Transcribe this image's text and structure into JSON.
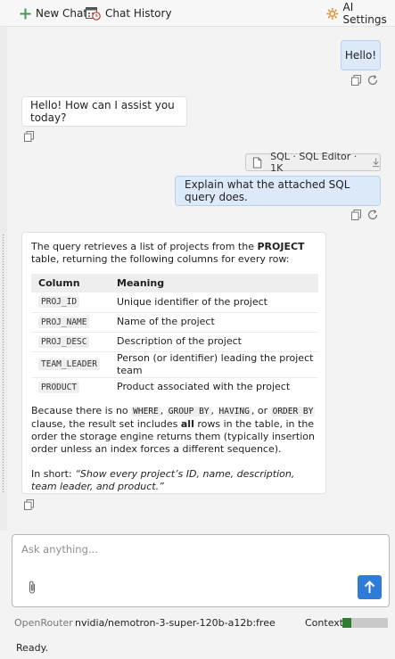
{
  "toolbar": {
    "new_chat": "New Chat",
    "chat_history": "Chat History",
    "ai_settings": "AI Settings"
  },
  "messages": {
    "user_1": "Hello!",
    "ai_1": "Hello! How can I assist you today?",
    "attachment": {
      "label": "SQL · SQL Editor · 1K"
    },
    "user_2": "Explain what the attached SQL query does.",
    "ai_2": {
      "intro_prefix": "The query retrieves a list of projects from the ",
      "intro_table": "PROJECT",
      "intro_suffix": " table, returning the following columns for every row:",
      "table_headers": [
        "Column",
        "Meaning"
      ],
      "rows": [
        {
          "column": "PROJ_ID",
          "meaning": "Unique identifier of the project"
        },
        {
          "column": "PROJ_NAME",
          "meaning": "Name of the project"
        },
        {
          "column": "PROJ_DESC",
          "meaning": "Description of the project"
        },
        {
          "column": "TEAM_LEADER",
          "meaning": "Person (or identifier) leading the project team"
        },
        {
          "column": "PRODUCT",
          "meaning": "Product associated with the project"
        }
      ],
      "para2_a": "Because there is no ",
      "kw_where": "WHERE",
      "para2_b": ", ",
      "kw_group": "GROUP BY",
      "para2_c": ", ",
      "kw_having": "HAVING",
      "para2_d": ", or ",
      "kw_order": "ORDER BY",
      "para2_e": " clause, the result set includes ",
      "para2_all": "all",
      "para2_f": " rows in the table, in the order the storage engine returns them (typically insertion order unless an index forces a different sequence).",
      "short_prefix": "In short: ",
      "short_quote": "“Show every project’s ID, name, description, team leader, and product.”"
    }
  },
  "input": {
    "placeholder": "Ask anything..."
  },
  "model_bar": {
    "provider": "OpenRouter",
    "model": "nvidia/nemotron-3-super-120b-a12b:free",
    "context_label": "Context:",
    "context_fill": 0.2
  },
  "status": {
    "text": "Ready."
  },
  "colors": {
    "accent": "#2f7bd8",
    "user_bubble": "#dce9f8",
    "context_fill": "#2e7d32"
  }
}
